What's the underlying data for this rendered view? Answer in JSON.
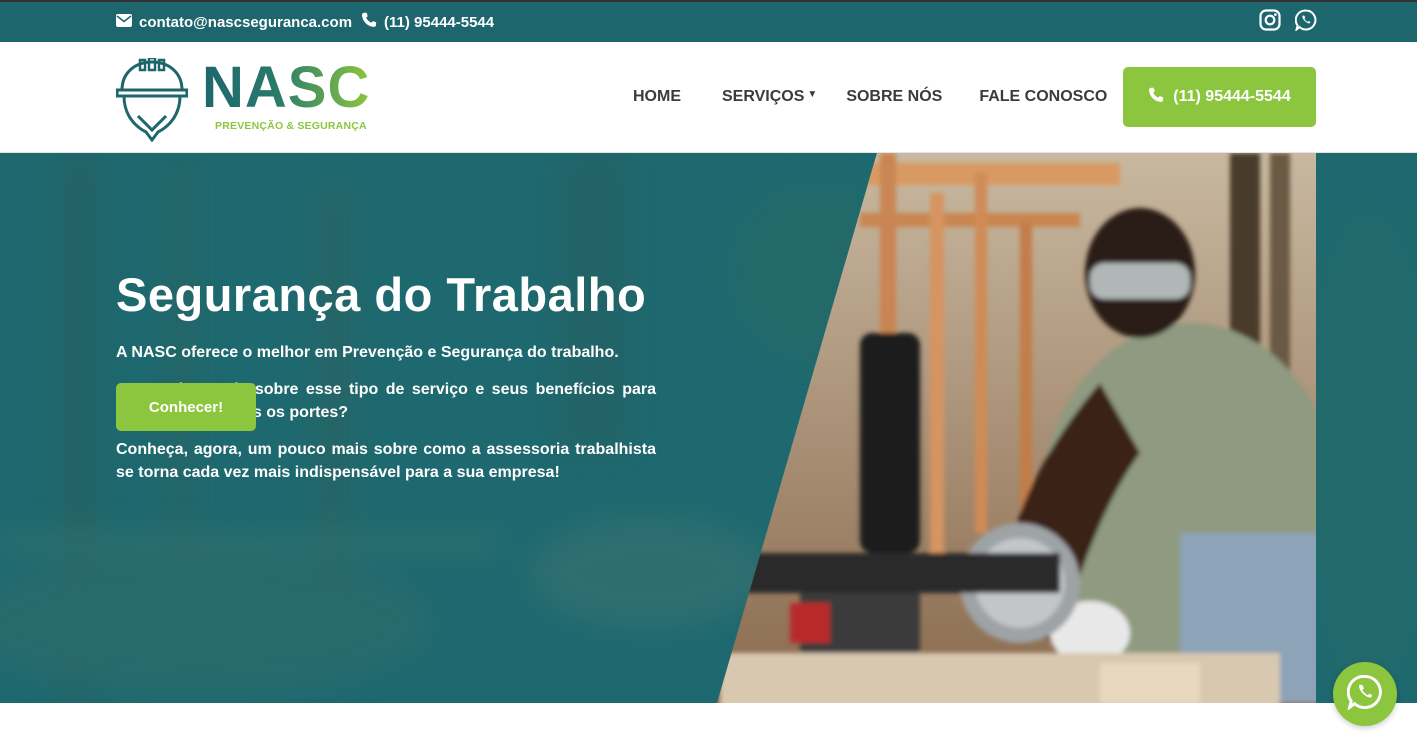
{
  "topbar": {
    "email": "contato@nascseguranca.com",
    "phone": "(11) 95444-5544",
    "icons": [
      "envelope-icon",
      "phone-icon",
      "instagram-icon",
      "whatsapp-icon"
    ]
  },
  "header": {
    "logo_text": "NASC",
    "logo_tagline": "PREVENÇÃO & SEGURANÇA",
    "nav": [
      {
        "label": "HOME"
      },
      {
        "label": "SERVIÇOS"
      },
      {
        "label": "SOBRE NÓS"
      },
      {
        "label": "FALE CONOSCO"
      }
    ],
    "cta_phone": "(11) 95444-5544"
  },
  "hero": {
    "title": "Segurança do Trabalho",
    "paragraphs": [
      "A NASC oferece o melhor em Prevenção e Segurança do trabalho.",
      "Quer saber mais sobre esse tipo de serviço e seus benefícios para empresas de todos os portes?",
      "Conheça, agora, um pouco mais sobre como a assessoria trabalhista se torna cada vez mais indispensável para a sua empresa!"
    ],
    "button_label": "Conhecer!"
  },
  "colors": {
    "primary": "#1e666e",
    "accent": "#8cc63f",
    "text_dark": "#3b3b3b"
  }
}
